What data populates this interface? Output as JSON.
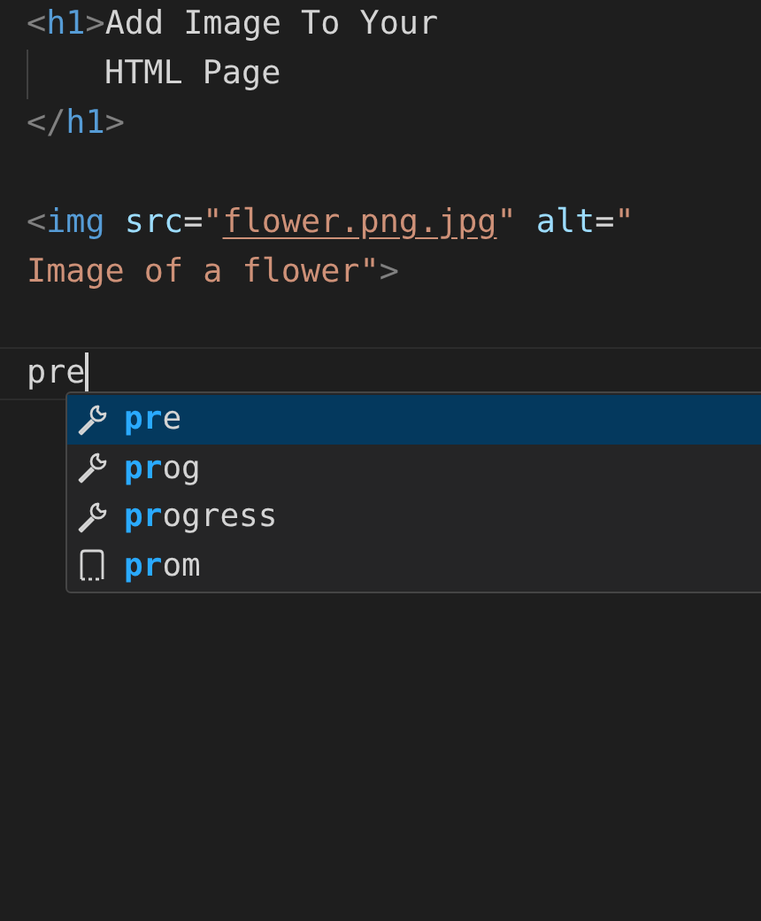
{
  "editor": {
    "lines": [
      {
        "kind": "code",
        "wrapped": false,
        "current": false,
        "tokens": [
          {
            "kind": "punct",
            "text": "<"
          },
          {
            "kind": "tag",
            "text": "h1"
          },
          {
            "kind": "punct",
            "text": ">"
          },
          {
            "kind": "text",
            "text": "Add Image To Your"
          }
        ]
      },
      {
        "kind": "code",
        "wrapped": true,
        "current": false,
        "tokens": [
          {
            "kind": "text",
            "text": "HTML Page"
          }
        ]
      },
      {
        "kind": "code",
        "wrapped": false,
        "current": false,
        "tokens": [
          {
            "kind": "punct",
            "text": "</"
          },
          {
            "kind": "tag",
            "text": "h1"
          },
          {
            "kind": "punct",
            "text": ">"
          }
        ]
      },
      {
        "kind": "blank"
      },
      {
        "kind": "code",
        "wrapped": false,
        "current": false,
        "tokens": [
          {
            "kind": "punct",
            "text": "<"
          },
          {
            "kind": "tag",
            "text": "img"
          },
          {
            "kind": "attr",
            "text": " src"
          },
          {
            "kind": "text",
            "text": "="
          },
          {
            "kind": "string",
            "text": "\""
          },
          {
            "kind": "link",
            "text": "flower.png.jpg"
          },
          {
            "kind": "string",
            "text": "\""
          },
          {
            "kind": "attr",
            "text": " alt"
          },
          {
            "kind": "text",
            "text": "="
          },
          {
            "kind": "string",
            "text": "\""
          }
        ]
      },
      {
        "kind": "code",
        "wrapped": false,
        "current": false,
        "tokens": [
          {
            "kind": "string",
            "text": "Image of a flower\""
          },
          {
            "kind": "punct",
            "text": ">"
          }
        ]
      },
      {
        "kind": "blank"
      },
      {
        "kind": "code",
        "wrapped": false,
        "current": true,
        "tokens": [
          {
            "kind": "text",
            "text": "pre"
          }
        ]
      }
    ]
  },
  "suggestions": [
    {
      "kind": "snippet",
      "match": "pr",
      "rest": "e",
      "selected": true
    },
    {
      "kind": "snippet",
      "match": "pr",
      "rest": "og",
      "selected": false
    },
    {
      "kind": "snippet",
      "match": "pr",
      "rest": "ogress",
      "selected": false
    },
    {
      "kind": "property",
      "match": "pr",
      "rest": "om",
      "selected": false
    }
  ]
}
